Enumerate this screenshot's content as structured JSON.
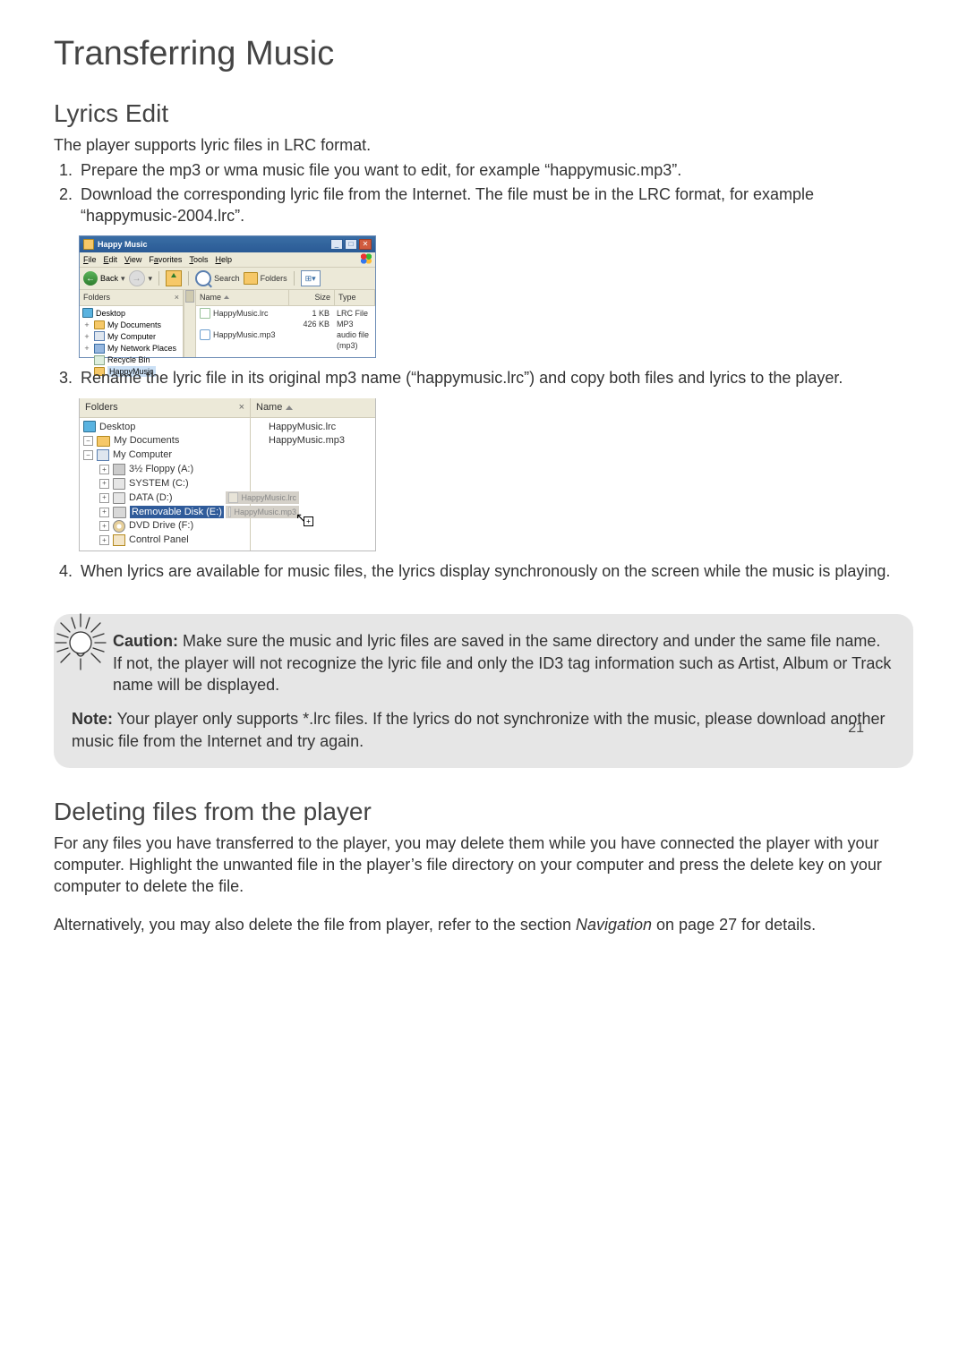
{
  "page_number": "21",
  "title": "Transferring Music",
  "section1": {
    "heading": "Lyrics Edit",
    "intro": "The player supports lyric files in LRC format.",
    "step1": "Prepare the mp3 or wma music file you want to edit, for example “happymusic.mp3”.",
    "step2": "Download the corresponding lyric file from the Internet. The file must be in the LRC format, for example “happymusic-2004.lrc”.",
    "step3": "Rename the lyric file in its original mp3 name (“happymusic.lrc”) and copy both files and lyrics to the player.",
    "step4": "When lyrics are available for music files, the lyrics display synchronously on the screen while the music is playing."
  },
  "shot1": {
    "title": "Happy Music",
    "menu": {
      "file": "File",
      "edit": "Edit",
      "view": "View",
      "favorites": "Favorites",
      "tools": "Tools",
      "help": "Help"
    },
    "toolbar": {
      "back": "Back",
      "search": "Search",
      "folders": "Folders"
    },
    "folders_header": "Folders",
    "tree": {
      "desktop": "Desktop",
      "mydocs": "My Documents",
      "mycomp": "My Computer",
      "netplaces": "My Network Places",
      "recycle": "Recycle Bin",
      "happy": "HappyMusic"
    },
    "list_headers": {
      "name": "Name",
      "size": "Size",
      "type": "Type"
    },
    "rows": [
      {
        "name": "HappyMusic.lrc",
        "size": "1 KB",
        "type": "LRC File"
      },
      {
        "name": "HappyMusic.mp3",
        "size": "426 KB",
        "type": "MP3 audio file (mp3)"
      }
    ]
  },
  "shot2": {
    "folders_header": "Folders",
    "name_header": "Name",
    "tree": {
      "desktop": "Desktop",
      "mydocs": "My Documents",
      "mycomp": "My Computer",
      "floppy": "3½ Floppy (A:)",
      "sysc": "SYSTEM (C:)",
      "datad": "DATA (D:)",
      "remov": "Removable Disk (E:)",
      "dvd": "DVD Drive (F:)",
      "ctrl": "Control Panel"
    },
    "files": {
      "lrc": "HappyMusic.lrc",
      "mp3": "HappyMusic.mp3"
    },
    "ghost1": "HappyMusic.lrc",
    "ghost2": "HappyMusic.mp3"
  },
  "callout": {
    "caution_label": "Caution:",
    "caution_text": " Make sure the music and lyric files are saved in the same directory and under the same file name. If not, the player will not recognize the lyric file and only the ID3 tag information such as Artist, Album or Track name will be displayed.",
    "note_label": "Note:",
    "note_text": " Your player only supports *.lrc files. If the lyrics do not synchronize with the music, please download another music file from the Internet and try again."
  },
  "section2": {
    "heading": "Deleting files from the player",
    "p1": "For any files you have transferred to the player, you may delete them while you have connected the player with your computer. Highlight the unwanted file in the player’s file directory on your computer and press the delete key on your computer to delete the file.",
    "p2a": "Alternatively, you may also delete the file from player, refer to the section ",
    "p2_em": "Navigation",
    "p2b": " on page 27 for details."
  }
}
